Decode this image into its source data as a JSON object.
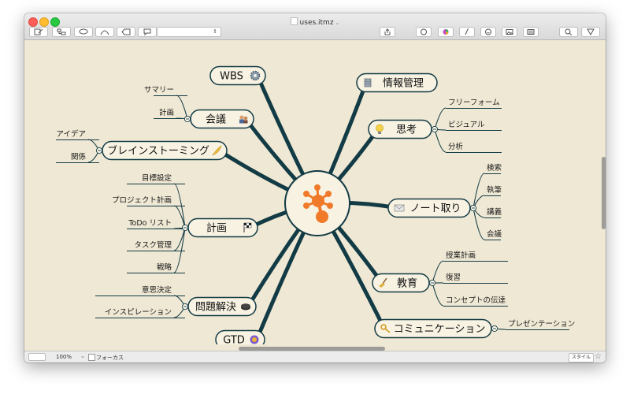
{
  "window": {
    "title": "uses.itmz"
  },
  "toolbar": {
    "style_select_value": ""
  },
  "map": {
    "central_topic": "",
    "topics": [
      {
        "label": "WBS",
        "icon": "gear-icon",
        "children": []
      },
      {
        "label": "会議",
        "icon": "people-icon",
        "children": [
          "サマリー",
          "計画"
        ]
      },
      {
        "label": "ブレインストーミング",
        "icon": "feather-icon",
        "children": [
          "アイデア",
          "関係"
        ]
      },
      {
        "label": "計画",
        "icon": "checkered-flag-icon",
        "children": [
          "目標設定",
          "プロジェクト計画",
          "ToDo リスト",
          "タスク管理",
          "戦略"
        ]
      },
      {
        "label": "問題解決",
        "icon": "hockey-puck-icon",
        "children": [
          "意思決定",
          "インスピレーション"
        ]
      },
      {
        "label": "GTD",
        "icon": "orb-icon",
        "children": []
      },
      {
        "label": "情報管理",
        "icon": "database-icon",
        "children": []
      },
      {
        "label": "思考",
        "icon": "lightbulb-icon",
        "children": [
          "フリーフォーム",
          "ビジュアル",
          "分析"
        ]
      },
      {
        "label": "ノート取り",
        "icon": "envelope-icon",
        "children": [
          "検索",
          "執筆",
          "講義",
          "会議"
        ]
      },
      {
        "label": "教育",
        "icon": "broom-icon",
        "children": [
          "授業計画",
          "復習",
          "コンセプトの伝達"
        ]
      },
      {
        "label": "コミュニケーション",
        "icon": "key-icon",
        "children": [
          "プレゼンテーション"
        ]
      }
    ]
  },
  "statusbar": {
    "zoom": "100%",
    "focus_label": "フォーカス",
    "style_button": "スタイル"
  },
  "colors": {
    "background": "#efe8d4",
    "branch": "#123b45",
    "node_fill": "#f7f2e2",
    "logo": "#f07a2a"
  }
}
